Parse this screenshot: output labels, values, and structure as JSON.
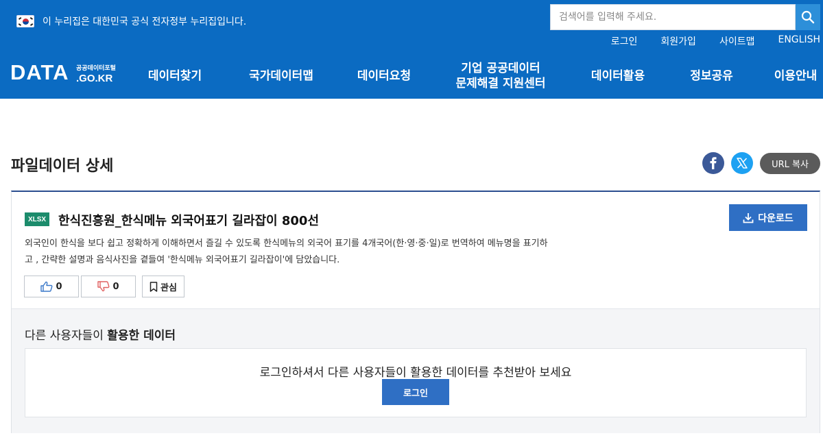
{
  "header": {
    "gov_notice": "이 누리집은 대한민국 공식 전자정부 누리집입니다.",
    "search_placeholder": "검색어를 입력해 주세요.",
    "top_links": [
      "로그인",
      "회원가입",
      "사이트맵",
      "ENGLISH"
    ],
    "logo": {
      "main": "DATA",
      "sub_top": "공공데이터포털",
      "sub_bottom": ".GO.KR"
    },
    "nav": [
      {
        "line1": "데이터찾기"
      },
      {
        "line1": "국가데이터맵"
      },
      {
        "line1": "데이터요청"
      },
      {
        "line1": "기업 공공데이터",
        "line2": "문제해결 지원센터"
      },
      {
        "line1": "데이터활용"
      },
      {
        "line1": "정보공유"
      },
      {
        "line1": "이용안내"
      }
    ],
    "colors": {
      "header_bg": "#0b6bc2",
      "search_btn": "#2d8fd9"
    }
  },
  "page": {
    "title": "파일데이터 상세",
    "share": {
      "facebook": "facebook-icon",
      "x": "x-icon",
      "url_copy_label": "URL 복사"
    }
  },
  "dataset": {
    "format": "XLSX",
    "title": "한식진흥원_한식메뉴 외국어표기 길라잡이 800선",
    "download_label": "다운로드",
    "description_line1": "외국인이 한식을 보다 쉽고 정확하게 이해하면서 즐길 수 있도록 한식메뉴의 외국어 표기를 4개국어(한·영·중·일)로 번역하여 메뉴명을 표기하",
    "description_line2": "고 , 간략한 설명과 음식사진을 곁들여 '한식메뉴 외국어표기 길라잡이'에 담았습니다.",
    "likes": "0",
    "dislikes": "0",
    "interest_label": "관심",
    "colors": {
      "badge": "#1c8c6c",
      "button": "#2f6fc4"
    }
  },
  "recommend": {
    "title_prefix": "다른 사용자들이 ",
    "title_bold": "활용한 데이터",
    "message": "로그인하셔서 다른 사용자들이 활용한 데이터를 추천받아 보세요",
    "login_label": "로그인"
  }
}
